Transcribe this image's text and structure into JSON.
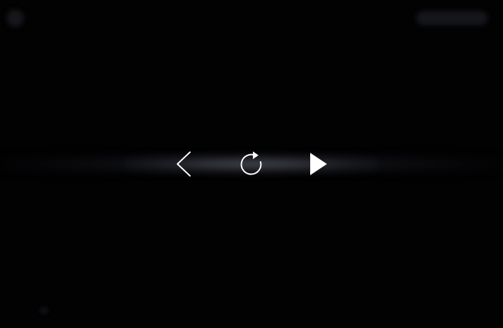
{
  "player": {
    "controls": [
      {
        "id": "previous",
        "icon": "chevron-left-icon"
      },
      {
        "id": "replay",
        "icon": "replay-icon"
      },
      {
        "id": "play",
        "icon": "play-icon"
      }
    ],
    "colors": {
      "background": "#020203",
      "icon": "#ffffff",
      "glow": "#5f6473"
    }
  }
}
